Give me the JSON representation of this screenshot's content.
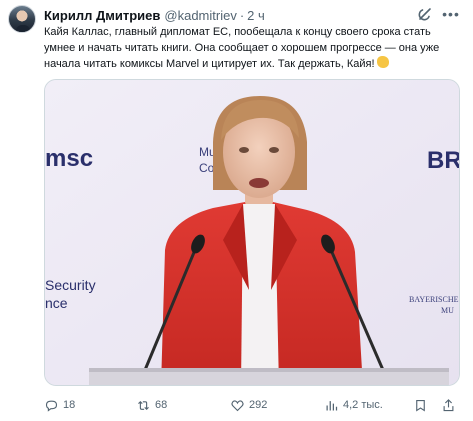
{
  "tweet": {
    "author_name": "Кирилл Дмитриев",
    "author_handle": "@kadmitriev",
    "separator": "·",
    "time": "2 ч",
    "text": "Кайя Каллас, главный дипломат ЕС, пообещала к концу своего срока стать умнее и начать читать книги. Она сообщает о хорошем прогрессе — она уже начала читать комиксы Marvel и цитирует их. Так держать, Кайя!"
  },
  "media": {
    "backdrop_text": {
      "left_logo": "msc",
      "center_line1": "Munich Security",
      "center_line2": "Conference",
      "left_bottom_line1": "Security",
      "left_bottom_line2": "nce",
      "right_logo": "BR",
      "right_bottom_line1": "BAYERISCHE",
      "right_bottom_line2": "MU"
    }
  },
  "actions": {
    "replies": "18",
    "reposts": "68",
    "likes": "292",
    "views": "4,2 тыс."
  },
  "colors": {
    "text_primary": "#0f1419",
    "text_secondary": "#536471",
    "jacket_red": "#d8322c",
    "backdrop": "#eeeaf5",
    "msc_blue": "#2a2f6b"
  }
}
